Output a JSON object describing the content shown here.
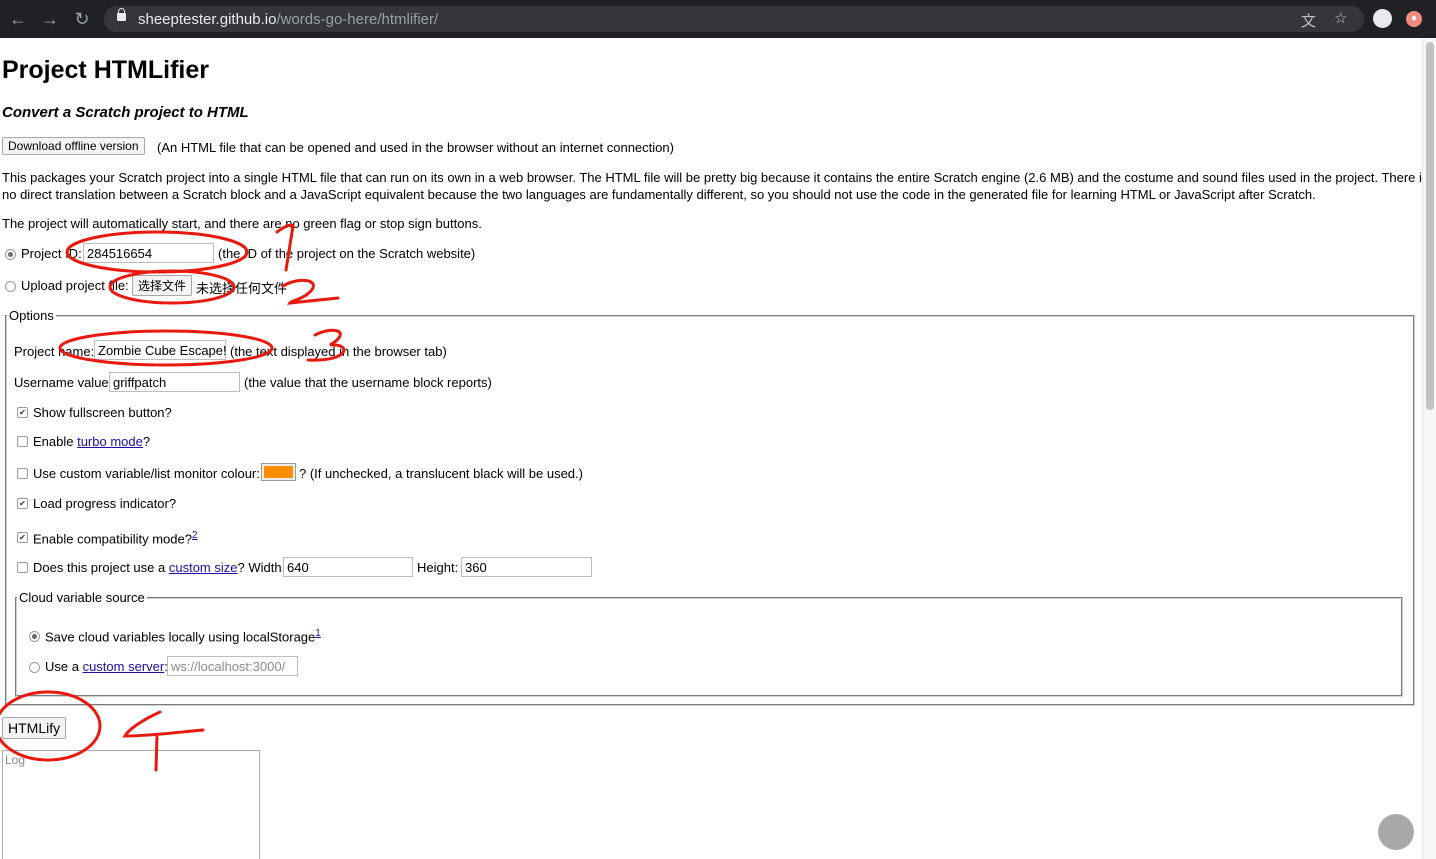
{
  "browser": {
    "url_host": "sheeptester.github.io",
    "url_path": "/words-go-here/htmlifier/"
  },
  "page": {
    "title": "Project HTMLifier",
    "subtitle": "Convert a Scratch project to HTML",
    "download_button": "Download offline version",
    "download_note": "(An HTML file that can be opened and used in the browser without an internet connection)",
    "description_line1": "This packages your Scratch project into a single HTML file that can run on its own in a web browser. The HTML file will be pretty big because it contains the entire Scratch engine (2.6 MB) and the costume and sound files used in the project. There is",
    "description_line2": "no direct translation between a Scratch block and a JavaScript equivalent because the two languages are fundamentally different, so you should not use the code in the generated file for learning HTML or JavaScript after Scratch.",
    "autostart_note": "The project will automatically start, and there are no green flag or stop sign buttons."
  },
  "source": {
    "project_id_label": "Project ID:",
    "project_id_value": "284516654",
    "project_id_note": "(the ID of the project on the Scratch website)",
    "upload_label": "Upload project file:",
    "choose_file_button": "选择文件",
    "no_file_text": "未选择任何文件"
  },
  "options": {
    "legend": "Options",
    "project_name_label": "Project name:",
    "project_name_value": "Zombie Cube Escape!",
    "project_name_note": "(the text displayed in the browser tab)",
    "username_label": "Username value:",
    "username_value": "griffpatch",
    "username_note": "(the value that the username block reports)",
    "fullscreen_label": "Show fullscreen button?",
    "turbo_prefix": "Enable ",
    "turbo_link": "turbo mode",
    "turbo_suffix": "?",
    "monitor_label": "Use custom variable/list monitor colour:",
    "monitor_note": "? (If unchecked, a translucent black will be used.)",
    "monitor_color": "#ff8c00",
    "progress_label": "Load progress indicator?",
    "compat_label": "Enable compatibility mode?",
    "compat_footnote": "2",
    "size_prefix": "Does this project use a ",
    "size_link": "custom size",
    "size_suffix": "? Width:",
    "width_value": "640",
    "height_label": "Height:",
    "height_value": "360"
  },
  "cloud": {
    "legend": "Cloud variable source",
    "local_label": "Save cloud variables locally using localStorage",
    "local_footnote": "1",
    "server_prefix": "Use a ",
    "server_link": "custom server",
    "server_suffix": ":",
    "server_placeholder": "ws://localhost:3000/"
  },
  "actions": {
    "htmlify_button": "HTMLify",
    "log_placeholder": "Log"
  },
  "annotations": {
    "color": "#e8190f",
    "numbers": [
      "1",
      "2",
      "3",
      "4"
    ]
  }
}
